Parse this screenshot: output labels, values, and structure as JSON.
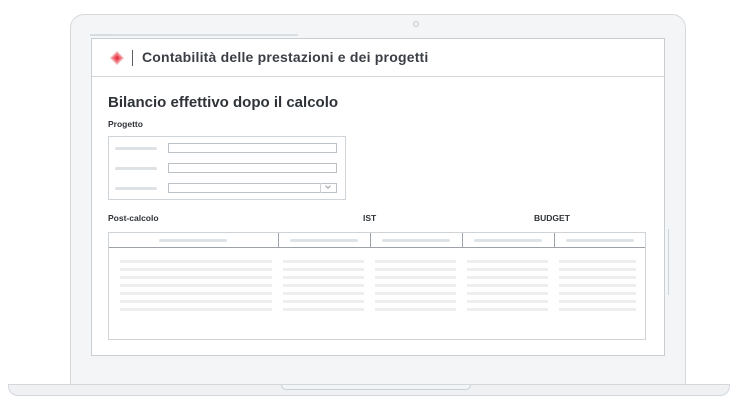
{
  "colors": {
    "accent": "#e63946",
    "brand": "#e63946"
  },
  "app": {
    "logo_icon": "diamond-logo-icon",
    "title": "Contabilità delle prestazioni e dei progetti"
  },
  "page": {
    "section_title": "Bilancio effettivo dopo il calcolo",
    "project_label": "Progetto"
  },
  "table": {
    "label": "Post-calcolo",
    "column_headers": [
      "IST",
      "BUDGET"
    ],
    "dropdown_icon": "chevron-down-icon"
  }
}
